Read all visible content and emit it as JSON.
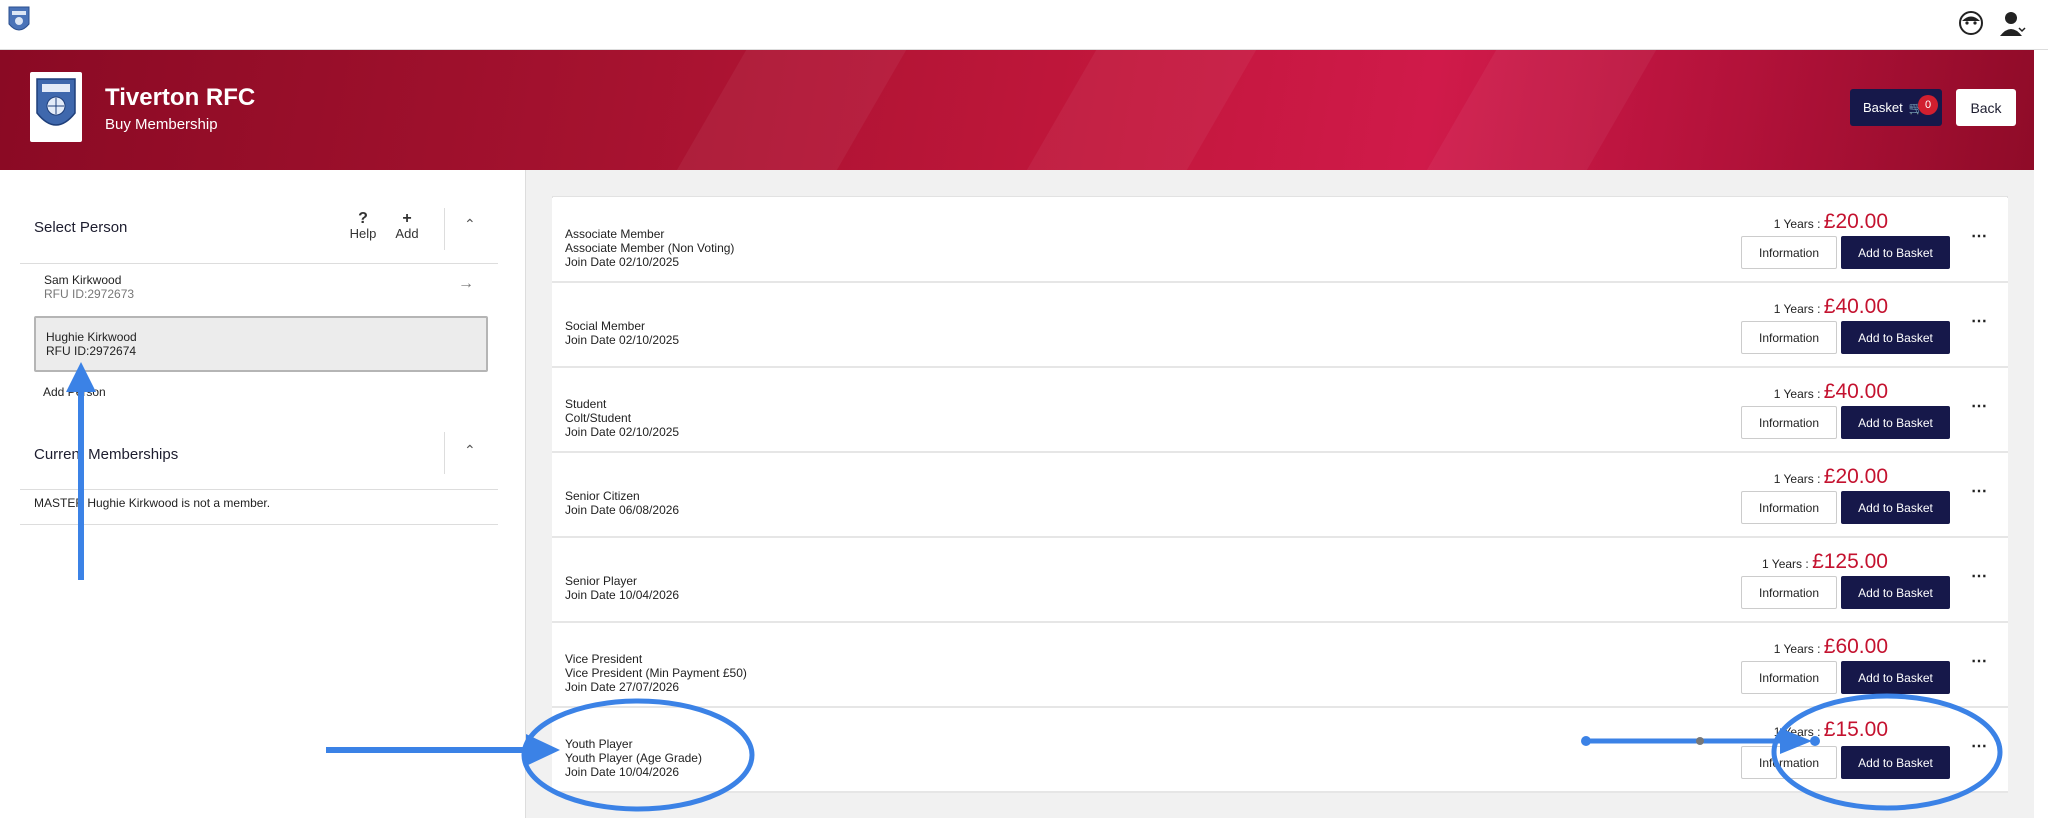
{
  "header": {
    "club_name": "Tiverton RFC",
    "subtitle": "Buy Membership",
    "basket_label": "Basket",
    "basket_count": "0",
    "back_label": "Back"
  },
  "sidebar": {
    "select_person_label": "Select Person",
    "help_label": "Help",
    "add_label": "Add",
    "people": [
      {
        "name": "Sam Kirkwood",
        "id": "RFU ID:2972673"
      },
      {
        "name": "Hughie Kirkwood",
        "id": "RFU ID:2972674"
      }
    ],
    "add_person_label": "Add Person",
    "current_memberships_label": "Current Memberships",
    "not_member_text": "MASTER Hughie Kirkwood is not a member."
  },
  "memberships": [
    {
      "title": "Associate Member",
      "subtitle": "Associate Member (Non Voting)",
      "join": "Join Date 02/10/2025",
      "years": "1 Years :",
      "price": "£20.00"
    },
    {
      "title": "Social Member",
      "subtitle": "",
      "join": "Join Date 02/10/2025",
      "years": "1 Years :",
      "price": "£40.00"
    },
    {
      "title": "Student",
      "subtitle": "Colt/Student",
      "join": "Join Date 02/10/2025",
      "years": "1 Years :",
      "price": "£40.00"
    },
    {
      "title": "Senior Citizen",
      "subtitle": "",
      "join": "Join Date 06/08/2026",
      "years": "1 Years :",
      "price": "£20.00"
    },
    {
      "title": "Senior Player",
      "subtitle": "",
      "join": "Join Date 10/04/2026",
      "years": "1 Years :",
      "price": "£125.00"
    },
    {
      "title": "Vice President",
      "subtitle": "Vice President (Min Payment £50)",
      "join": "Join Date 27/07/2026",
      "years": "1 Years :",
      "price": "£60.00"
    },
    {
      "title": "Youth Player",
      "subtitle": "Youth Player (Age Grade)",
      "join": "Join Date 10/04/2026",
      "years": "1 Years :",
      "price": "£15.00"
    }
  ],
  "buttons": {
    "information_label": "Information",
    "add_to_basket_label": "Add to Basket"
  },
  "icons": {
    "support": "support-face-icon",
    "account": "account-icon",
    "help": "question-icon",
    "add": "plus-icon",
    "collapse": "chevron-up-icon",
    "go": "arrow-right-icon",
    "basket": "basket-icon",
    "more": "ellipsis-icon"
  },
  "colors": {
    "banner": "#a5122f",
    "navy": "#16184a",
    "price": "#c4122f",
    "annotation": "#3b82e6"
  }
}
